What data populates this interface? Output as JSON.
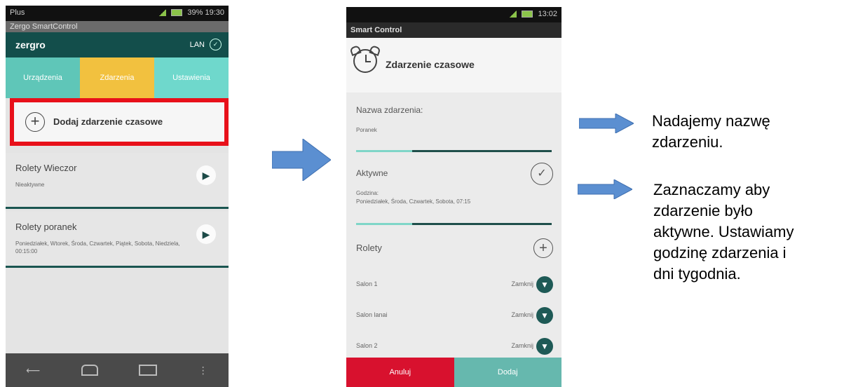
{
  "phone1": {
    "status": {
      "left": "Plus",
      "right": "39% 19:30"
    },
    "titlebar": "Zergo SmartControl",
    "header": {
      "logo": "zergro",
      "lan": "LAN"
    },
    "tabs": [
      "Urządzenia",
      "Zdarzenia",
      "Ustawienia"
    ],
    "add_event": "Dodaj zdarzenie czasowe",
    "events": [
      {
        "title": "Rolety Wieczor",
        "desc": "Nieaktywne"
      },
      {
        "title": "Rolety poranek",
        "desc": "Poniedziałek, Wtorek, Środa, Czwartek, Piątek, Sobota, Niedziela, 00:15:00"
      }
    ]
  },
  "phone2": {
    "status": {
      "right": "13:02"
    },
    "titlebar": "Smart Control",
    "title": "Zdarzenie czasowe",
    "name_label": "Nazwa zdarzenia:",
    "name_value": "Poranek",
    "active_label": "Aktywne",
    "time_label": "Godzina:",
    "time_value": "Poniedziałek, Środa, Czwartek, Sobota, 07:15",
    "rollers_label": "Rolety",
    "rollers": [
      {
        "name": "Salon 1",
        "status": "Zamknij"
      },
      {
        "name": "Salon lanai",
        "status": "Zamknij"
      },
      {
        "name": "Salon 2",
        "status": "Zamknij"
      }
    ],
    "cancel": "Anuluj",
    "add": "Dodaj"
  },
  "notes": {
    "n1_line1": "Nadajemy nazwę",
    "n1_line2": "zdarzeniu.",
    "n2_line1": "Zaznaczamy aby",
    "n2_line2": "zdarzenie było",
    "n2_line3": "aktywne. Ustawiamy",
    "n2_line4": "godzinę zdarzenia i",
    "n2_line5": "dni tygodnia."
  },
  "colors": {
    "arrow": "#5b8fd1",
    "highlight": "#e8101a",
    "teal": "#134e4b"
  }
}
